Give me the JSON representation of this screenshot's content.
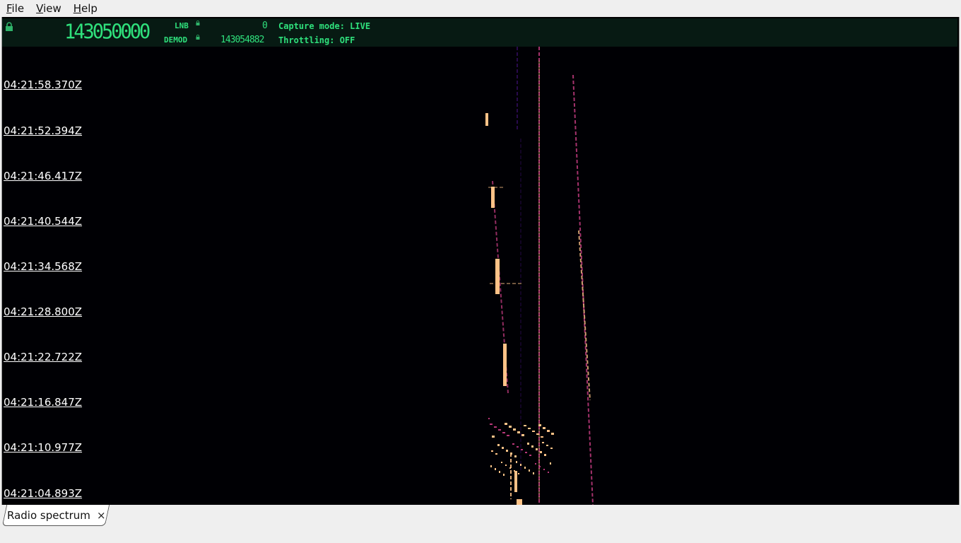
{
  "menu": {
    "items": [
      {
        "mnemonic": "F",
        "rest": "ile"
      },
      {
        "mnemonic": "V",
        "rest": "iew"
      },
      {
        "mnemonic": "H",
        "rest": "elp"
      }
    ]
  },
  "header": {
    "main_frequency": "143050000",
    "lnb_label": "LNB",
    "lnb_value": "0",
    "demod_label": "DEMOD",
    "demod_value": "143054882",
    "capture_mode": "Capture mode: LIVE",
    "throttling": "Throttling: OFF",
    "lock_icon": "lock-icon"
  },
  "waterfall": {
    "timestamps": [
      "04:21:58.370Z",
      "04:21:52.394Z",
      "04:21:46.417Z",
      "04:21:40.544Z",
      "04:21:34.568Z",
      "04:21:28.800Z",
      "04:21:22.722Z",
      "04:21:16.847Z",
      "04:21:10.977Z",
      "04:21:04.893Z"
    ],
    "colors": {
      "background": "#000004",
      "low": "#3b0f70",
      "mid": "#b73779",
      "high": "#fcfdbf",
      "hot": "#fec287"
    }
  },
  "tabs": [
    {
      "label": "Radio spectrum",
      "close_icon": "close-icon",
      "close_glyph": "×"
    }
  ]
}
